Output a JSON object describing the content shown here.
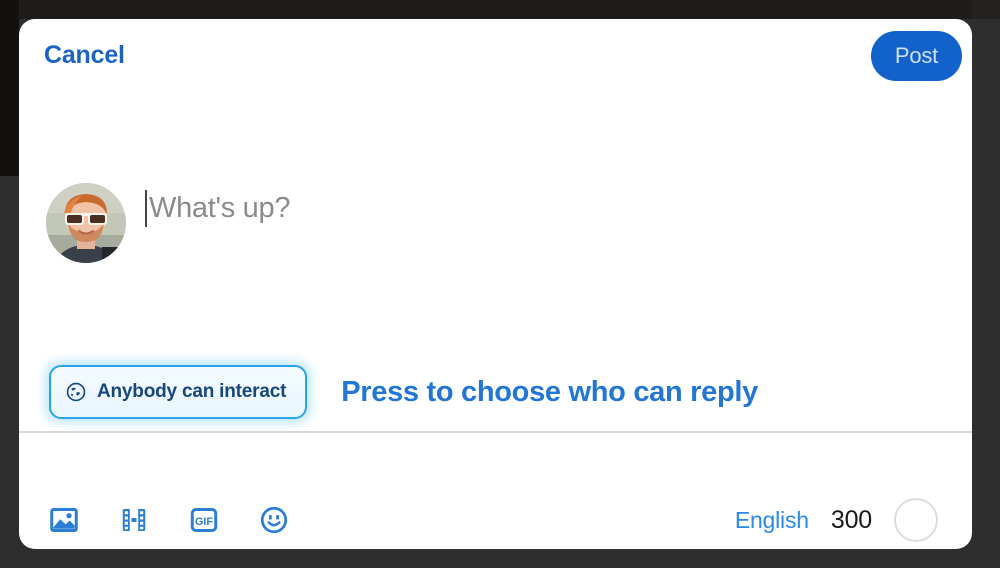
{
  "header": {
    "cancel_label": "Cancel",
    "post_label": "Post"
  },
  "composer": {
    "placeholder": "What's up?",
    "value": "",
    "avatar_alt": "user-avatar"
  },
  "audience": {
    "label": "Anybody can interact",
    "icon": "globe-icon"
  },
  "coach": {
    "text": "Press to choose who can reply"
  },
  "toolbar": {
    "icons": [
      {
        "name": "image-icon",
        "label": "Add photo"
      },
      {
        "name": "video-icon",
        "label": "Add video"
      },
      {
        "name": "gif-icon",
        "label": "GIF"
      },
      {
        "name": "emoji-icon",
        "label": "Emoji"
      }
    ],
    "gif_text": "GIF",
    "language_label": "English",
    "char_count": "300"
  },
  "colors": {
    "accent_blue": "#1362ca",
    "link_blue": "#2a8ae8",
    "cancel_blue": "#1a63c4",
    "coach_blue": "#2277d4",
    "pill_border": "#2aa3e8",
    "pill_text": "#18477e",
    "backdrop": "#2e2e2e",
    "sheet_bg": "#ffffff",
    "divider": "#d5d7d9",
    "placeholder_gray": "#8b8b8b"
  }
}
